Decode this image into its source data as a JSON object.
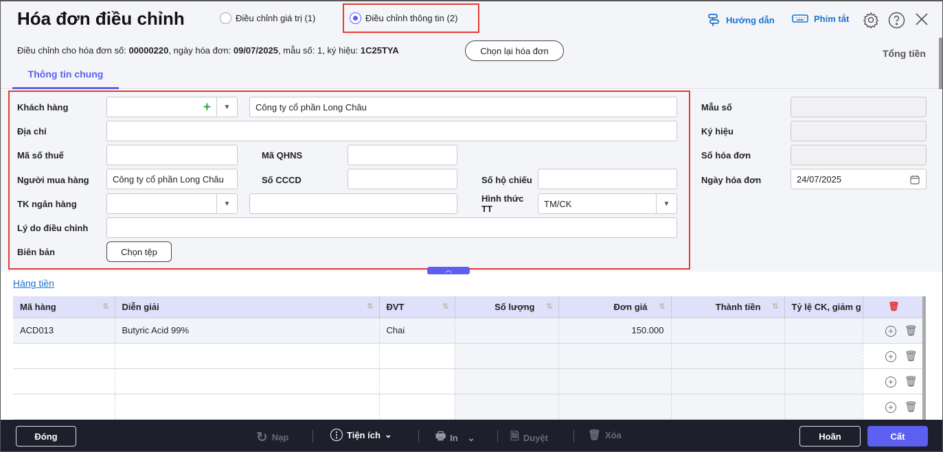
{
  "header": {
    "title": "Hóa đơn điều chỉnh",
    "options": [
      {
        "label": "Điều chỉnh giá trị (1)",
        "selected": false
      },
      {
        "label": "Điều chỉnh thông tin (2)",
        "selected": true
      }
    ],
    "guide": "Hướng dẫn",
    "shortcuts": "Phím tắt",
    "info": {
      "prefix": "Điều chỉnh cho hóa đơn số: ",
      "number": "00000220",
      "date_label": ", ngày hóa đơn: ",
      "date": "09/07/2025",
      "form_label": ", mẫu số: ",
      "form": "1",
      "symbol_label": ", ký hiệu: ",
      "symbol": "1C25TYA"
    },
    "reselect": "Chọn lại hóa đơn",
    "total": "Tổng tiền",
    "tab": "Thông tin chung"
  },
  "form": {
    "customer": {
      "label": "Khách hàng",
      "code": "",
      "name": "Công ty cổ phần Long Châu"
    },
    "address": {
      "label": "Địa chỉ",
      "value": ""
    },
    "tax": {
      "label": "Mã số thuế",
      "value": ""
    },
    "qhns": {
      "label": "Mã QHNS",
      "value": ""
    },
    "buyer": {
      "label": "Người mua hàng",
      "value": "Công ty cổ phần Long Châu"
    },
    "cccd": {
      "label": "Số CCCD",
      "value": ""
    },
    "passport": {
      "label": "Số hộ chiếu",
      "value": ""
    },
    "bank": {
      "label": "TK ngân hàng",
      "value": "",
      "bank_name": ""
    },
    "payment": {
      "label": "Hình thức TT",
      "value": "TM/CK"
    },
    "reason": {
      "label": "Lý do điều chỉnh",
      "value": ""
    },
    "record": {
      "label": "Biên bản",
      "button": "Chọn tệp"
    },
    "form_no": {
      "label": "Mẫu số",
      "value": ""
    },
    "symbol": {
      "label": "Ký hiệu",
      "value": ""
    },
    "invoice_no": {
      "label": "Số hóa đơn",
      "value": ""
    },
    "invoice_date": {
      "label": "Ngày hóa đơn",
      "value": "24/07/2025"
    }
  },
  "items": {
    "title": "Hàng tiền",
    "columns": [
      "Mã hàng",
      "Diễn giải",
      "ĐVT",
      "Số lượng",
      "Đơn giá",
      "Thành tiền",
      "Tỷ lệ CK, giảm g"
    ],
    "rows": [
      [
        "ACD013",
        "Butyric Acid 99%",
        "Chai",
        "",
        "150.000",
        "",
        ""
      ],
      [
        "",
        "",
        "",
        "",
        "",
        "",
        ""
      ],
      [
        "",
        "",
        "",
        "",
        "",
        "",
        ""
      ],
      [
        "",
        "",
        "",
        "",
        "",
        "",
        ""
      ]
    ]
  },
  "footer": {
    "close": "Đóng",
    "reload": "Nạp",
    "utilities": "Tiện ích",
    "print": "In",
    "approve": "Duyệt",
    "delete": "Xóa",
    "cancel": "Hoãn",
    "save": "Cất"
  },
  "colors": {
    "accent": "#5c5fef",
    "link": "#1a73d0",
    "highlight": "#e53935",
    "footer": "#1e1f2d"
  }
}
